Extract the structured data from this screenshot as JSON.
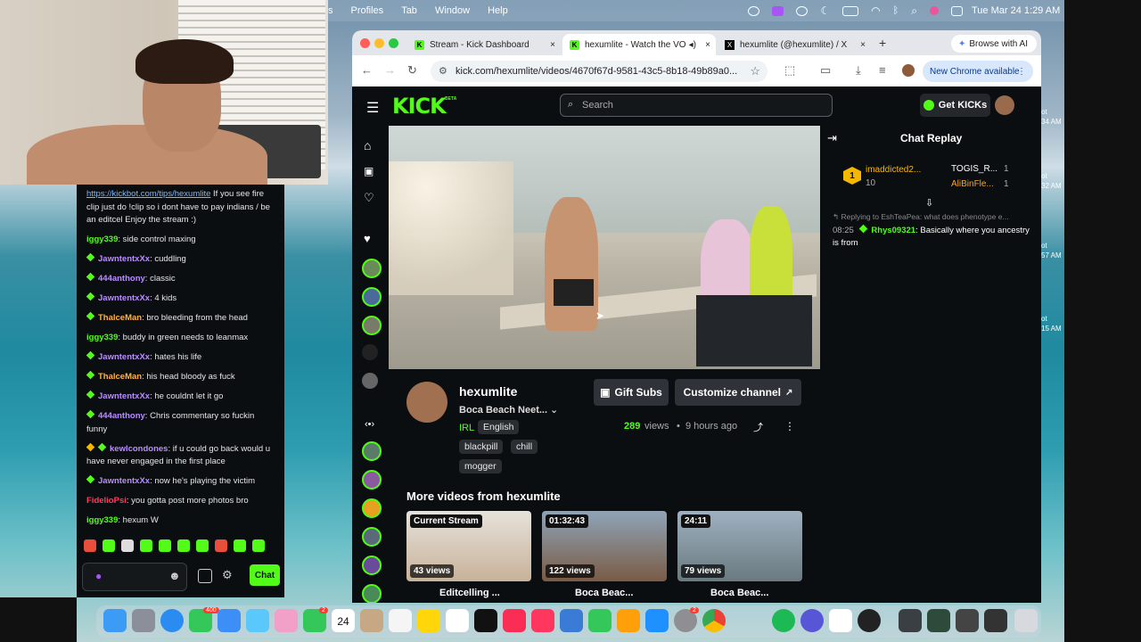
{
  "menubar": {
    "items": [
      "s",
      "Profiles",
      "Tab",
      "Window",
      "Help"
    ],
    "clock": "Tue Mar 24  1:29 AM"
  },
  "chat": {
    "messages": [
      {
        "user": "",
        "text_link": "https://kickbot.com/tips/hexumlite",
        "text": " If you see fire clip just do !clip so i dont have to pay indians / be an editcel Enjoy the stream :)",
        "color": "#e6e6e6",
        "badge": false
      },
      {
        "user": "iggy339",
        "text": "side control maxing",
        "color": "#53fc18",
        "badge": false
      },
      {
        "user": "JawntentxXx",
        "text": "cuddling",
        "color": "#b98cff",
        "badge": true
      },
      {
        "user": "444anthony",
        "text": "classic",
        "color": "#b98cff",
        "badge": true
      },
      {
        "user": "JawntentxXx",
        "text": "4 kids",
        "color": "#b98cff",
        "badge": true
      },
      {
        "user": "ThalceMan",
        "text": "bro bleeding from the head",
        "color": "#ffb347",
        "badge": true
      },
      {
        "user": "iggy339",
        "text": "buddy in green needs to leanmax",
        "color": "#53fc18",
        "badge": false
      },
      {
        "user": "JawntentxXx",
        "text": "hates his life",
        "color": "#b98cff",
        "badge": true
      },
      {
        "user": "ThalceMan",
        "text": "his head bloody as fuck",
        "color": "#ffb347",
        "badge": true
      },
      {
        "user": "JawntentxXx",
        "text": "he couldnt let it go",
        "color": "#b98cff",
        "badge": true
      },
      {
        "user": "444anthony",
        "text": "Chris commentary so fuckin funny",
        "color": "#b98cff",
        "badge": true
      },
      {
        "user": "kewlcondones",
        "text": "if u could go back would u have never engaged in the first place",
        "color": "#b98cff",
        "badge": true
      },
      {
        "user": "JawntentxXx",
        "text": "now he's playing the victim",
        "color": "#b98cff",
        "badge": true
      },
      {
        "user": "FidelioPsi",
        "text": "you gotta post more photos bro",
        "color": "#ff3b5c",
        "badge": false
      },
      {
        "user": "iggy339",
        "text": "hexum W",
        "color": "#53fc18",
        "badge": false
      }
    ],
    "chat_button": "Chat",
    "colon": ": "
  },
  "browser": {
    "tabs": [
      {
        "title": "Stream - Kick Dashboard",
        "fav": "K"
      },
      {
        "title": "hexumlite - Watch the VO",
        "fav": "K"
      },
      {
        "title": "hexumlite (@hexumlite) / X",
        "fav": "X"
      }
    ],
    "browse_ai": "Browse with AI",
    "url": "kick.com/hexumlite/videos/4670f67d-9581-43c5-8b18-49b89a0...",
    "new_chrome": "New Chrome available"
  },
  "kick": {
    "logo": "KICK",
    "beta": "BETA",
    "search_placeholder": "Search",
    "get_kicks": "Get KICKs",
    "channel": "hexumlite",
    "stream_title": "Boca Beach Neet...",
    "category": "IRL",
    "language": "English",
    "tags": [
      "blackpill",
      "chill",
      "mogger"
    ],
    "gift_subs": "Gift Subs",
    "customize": "Customize channel",
    "views": "289",
    "views_label": "views",
    "time_ago": "9 hours ago",
    "more_videos_title": "More videos from hexumlite",
    "videos": [
      {
        "badge": "Current Stream",
        "views": "43 views",
        "title": "Editcelling ..."
      },
      {
        "badge": "01:32:43",
        "views": "122 views",
        "title": "Boca Beac..."
      },
      {
        "badge": "24:11",
        "views": "79 views",
        "title": "Boca Beac..."
      }
    ]
  },
  "replay": {
    "title": "Chat Replay",
    "top_gifters": [
      {
        "name": "imaddicted2...",
        "count": "10"
      },
      {
        "name": "TOGIS_R...",
        "count": "1"
      },
      {
        "name": "AliBinFle...",
        "count": "1"
      }
    ],
    "rank": "1",
    "reply_to": "Replying to EshTeaPea: what does phenotype e...",
    "message": {
      "time": "08:25",
      "user": "Rhys09321",
      "text": "Basically where you ancestry is from"
    }
  },
  "desktop_right": [
    {
      "top": "ot",
      "bot": "34 AM"
    },
    {
      "top": "ot",
      "bot": "32 AM"
    },
    {
      "top": "ot",
      "bot": "57 AM"
    },
    {
      "top": "ot",
      "bot": "15 AM"
    }
  ],
  "dock_badges": [
    "400",
    "2",
    "2"
  ]
}
